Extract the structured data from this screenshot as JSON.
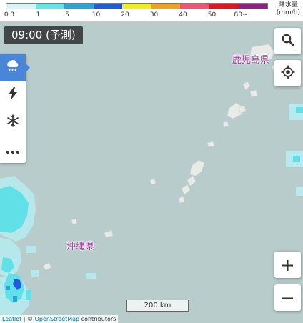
{
  "legend": {
    "colors": [
      "#d9f6f6",
      "#5ee6e9",
      "#2aa6d6",
      "#1e5cd8",
      "#f3ed18",
      "#f0a21b",
      "#f2546e",
      "#e3171a",
      "#8e2086"
    ],
    "ticks": [
      "0.3",
      "1",
      "5",
      "10",
      "20",
      "30",
      "40",
      "50",
      "80~"
    ],
    "unit_title": "降水量",
    "unit": "(mm/h)"
  },
  "time_badge": "09:00 (予測)",
  "layers": [
    {
      "icon": "rain-cloud-icon",
      "active": true
    },
    {
      "icon": "lightning-icon",
      "active": false
    },
    {
      "icon": "snowflake-icon",
      "active": false
    },
    {
      "icon": "more-icon",
      "active": false
    }
  ],
  "controls": {
    "search_icon": "search-icon",
    "locate_icon": "locate-icon",
    "zoom_in": "+",
    "zoom_out": "−"
  },
  "places": {
    "kagoshima": "鹿児島県",
    "okinawa": "沖縄県"
  },
  "scale": "200 km",
  "attribution": {
    "leaflet": "Leaflet",
    "sep": " | © ",
    "osm": "OpenStreetMap",
    "contrib": " contributors"
  }
}
